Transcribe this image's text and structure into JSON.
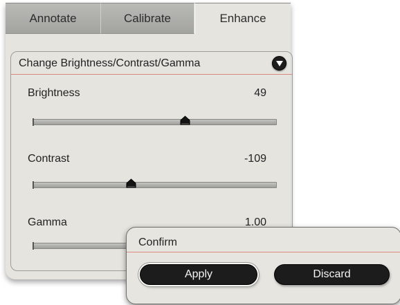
{
  "tabs": [
    {
      "label": "Annotate",
      "active": false
    },
    {
      "label": "Calibrate",
      "active": false
    },
    {
      "label": "Enhance",
      "active": true
    }
  ],
  "section": {
    "title": "Change Brightness/Contrast/Gamma",
    "collapse_icon": "chevron-down-icon"
  },
  "controls": {
    "brightness": {
      "label": "Brightness",
      "value": "49"
    },
    "contrast": {
      "label": "Contrast",
      "value": "-109"
    },
    "gamma": {
      "label": "Gamma",
      "value": "1.00"
    }
  },
  "dialog": {
    "title": "Confirm",
    "apply_label": "Apply",
    "discard_label": "Discard"
  },
  "colors": {
    "panel_bg": "#e5e4df",
    "divider_accent": "#d58a7c",
    "button_dark": "#1c1c1c"
  }
}
